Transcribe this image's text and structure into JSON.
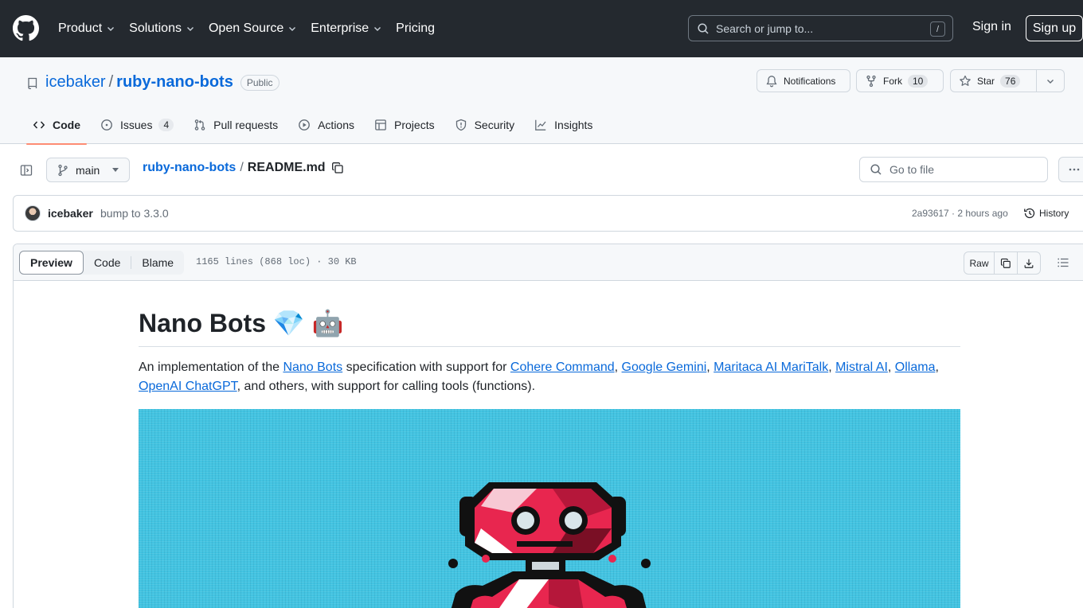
{
  "header": {
    "nav": [
      "Product",
      "Solutions",
      "Open Source",
      "Enterprise",
      "Pricing"
    ],
    "search_placeholder": "Search or jump to...",
    "search_shortcut": "/",
    "sign_in": "Sign in",
    "sign_up": "Sign up"
  },
  "repo": {
    "owner": "icebaker",
    "separator": "/",
    "name": "ruby-nano-bots",
    "visibility": "Public",
    "notifications_label": "Notifications",
    "fork_label": "Fork",
    "fork_count": "10",
    "star_label": "Star",
    "star_count": "76"
  },
  "tabs": {
    "code": "Code",
    "issues": "Issues",
    "issues_count": "4",
    "pull_requests": "Pull requests",
    "actions": "Actions",
    "projects": "Projects",
    "security": "Security",
    "insights": "Insights"
  },
  "file_nav": {
    "branch": "main",
    "crumb_repo": "ruby-nano-bots",
    "crumb_sep": "/",
    "crumb_file": "README.md",
    "goto_placeholder": "Go to file"
  },
  "commit": {
    "author": "icebaker",
    "message": "bump to 3.3.0",
    "meta": "2a93617 · 2 hours ago",
    "history": "History"
  },
  "file_toolbar": {
    "preview": "Preview",
    "code": "Code",
    "blame": "Blame",
    "info": "1165 lines (868 loc) · 30 KB",
    "raw": "Raw"
  },
  "readme": {
    "title": "Nano Bots 💎 🤖",
    "intro_prefix": "An implementation of the ",
    "link_nano_bots": "Nano Bots",
    "intro_mid": " specification with support for ",
    "link_cohere": "Cohere Command",
    "sep1": ", ",
    "link_gemini": "Google Gemini",
    "sep2": ", ",
    "link_maritaca": "Maritaca AI MariTalk",
    "sep3": ", ",
    "link_mistral": "Mistral AI",
    "sep4": ", ",
    "link_ollama": "Ollama",
    "sep5": ", ",
    "link_openai": "OpenAI ChatGPT",
    "intro_suffix": ", and others, with support for calling tools (functions)."
  },
  "colors": {
    "header_bg": "#24292f",
    "link": "#0969da",
    "tab_underline": "#fd8c73",
    "hero_bg": "#42c3e1",
    "robot_red": "#e8264f"
  }
}
